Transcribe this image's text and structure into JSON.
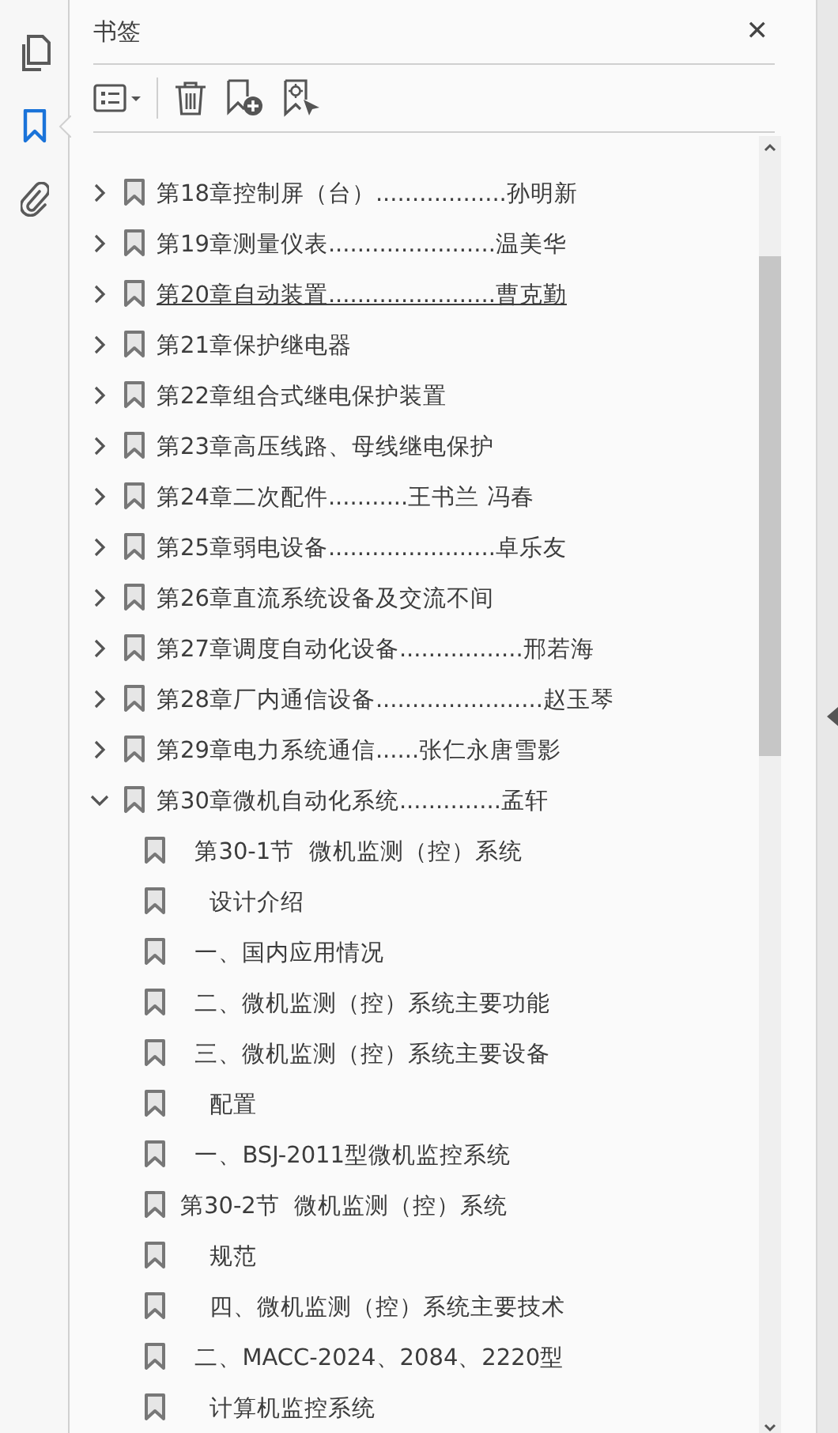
{
  "rail": [
    {
      "selected": false
    },
    {
      "selected": true
    },
    {
      "selected": false
    }
  ],
  "panel": {
    "title": "书签",
    "close": "✕"
  },
  "bookmarks": [
    {
      "label": "第18章控制屏（台）..................孙明新",
      "expanded": false,
      "hovered": false
    },
    {
      "label": "第19章测量仪表.......................温美华",
      "expanded": false,
      "hovered": false
    },
    {
      "label": "第20章自动装置.......................曹克勤",
      "expanded": false,
      "hovered": true
    },
    {
      "label": "第21章保护继电器",
      "expanded": false,
      "hovered": false
    },
    {
      "label": "第22章组合式继电保护装置",
      "expanded": false,
      "hovered": false
    },
    {
      "label": "第23章高压线路、母线继电保护",
      "expanded": false,
      "hovered": false
    },
    {
      "label": "第24章二次配件...........王书兰 冯春",
      "expanded": false,
      "hovered": false
    },
    {
      "label": "第25章弱电设备.......................卓乐友",
      "expanded": false,
      "hovered": false
    },
    {
      "label": "第26章直流系统设备及交流不间",
      "expanded": false,
      "hovered": false
    },
    {
      "label": "第27章调度自动化设备.................邢若海",
      "expanded": false,
      "hovered": false
    },
    {
      "label": "第28章厂内通信设备.......................赵玉琴",
      "expanded": false,
      "hovered": false
    },
    {
      "label": "第29章电力系统通信......张仁永唐雪影",
      "expanded": false,
      "hovered": false
    },
    {
      "label": "第30章微机自动化系统..............孟轩",
      "expanded": true,
      "hovered": false,
      "children": [
        {
          "label": "  第30-1节  微机监测（控）系统",
          "hovered": false
        },
        {
          "label": "    设计介绍",
          "hovered": false
        },
        {
          "label": "  一、国内应用情况",
          "hovered": false
        },
        {
          "label": "  二、微机监测（控）系统主要功能",
          "hovered": false
        },
        {
          "label": "  三、微机监测（控）系统主要设备",
          "hovered": false
        },
        {
          "label": "    配置",
          "hovered": false
        },
        {
          "label": "  一、BSJ-2011型微机监控系统",
          "hovered": false
        },
        {
          "label": "第30-2节  微机监测（控）系统",
          "hovered": false
        },
        {
          "label": "    规范",
          "hovered": false
        },
        {
          "label": "    四、微机监测（控）系统主要技术",
          "hovered": false
        },
        {
          "label": "  二、MACC-2024、2084、2220型",
          "hovered": false
        },
        {
          "label": "    计算机监控系统",
          "hovered": false
        }
      ]
    }
  ]
}
